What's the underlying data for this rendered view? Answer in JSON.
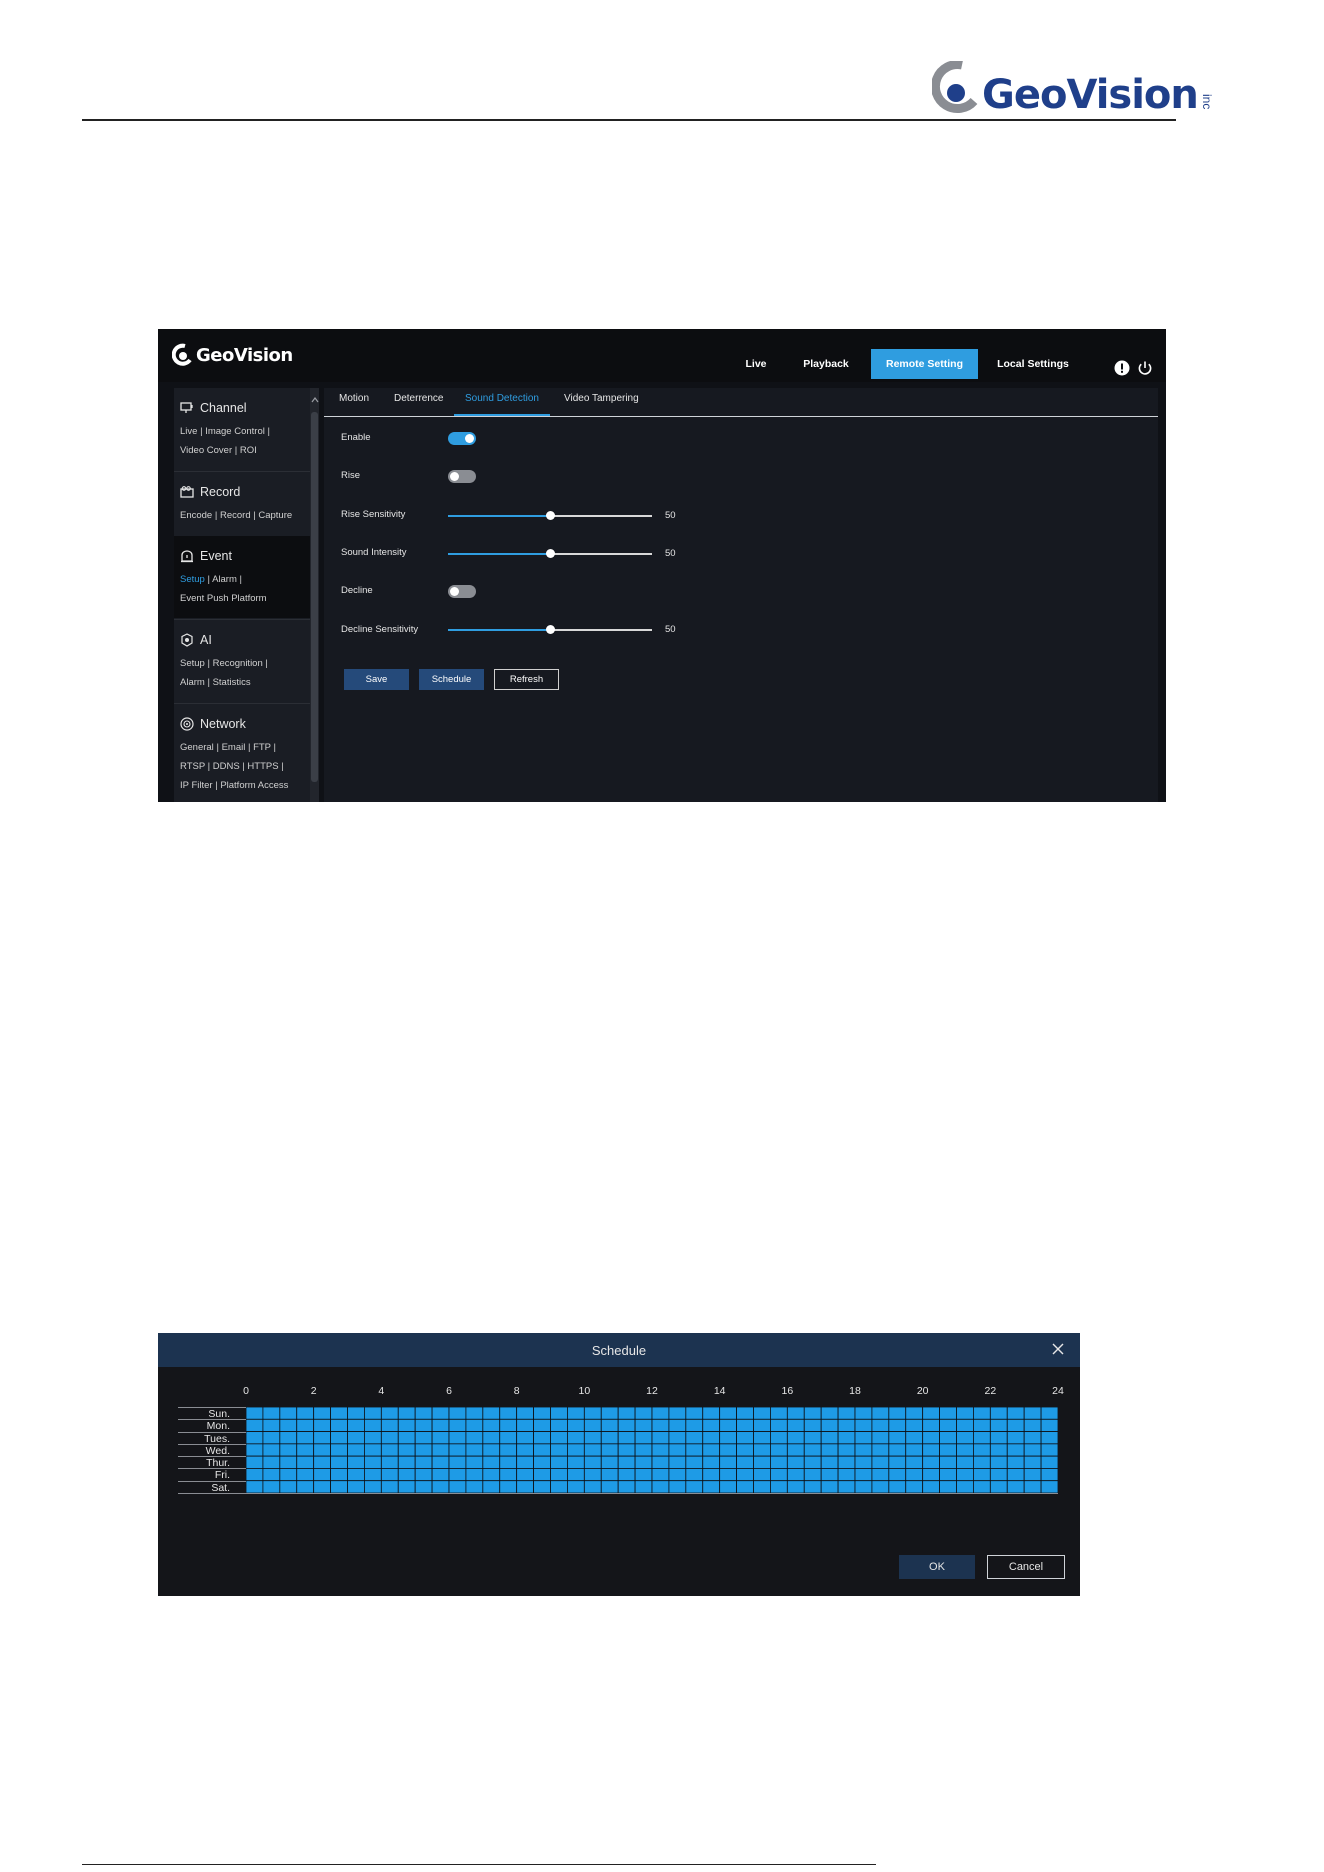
{
  "page_header": {
    "brand": "GeoVision",
    "brand_suffix": "inc"
  },
  "app": {
    "brand": "GeoVision",
    "nav": [
      {
        "label": "Live"
      },
      {
        "label": "Playback"
      },
      {
        "label": "Remote Setting"
      },
      {
        "label": "Local Settings"
      }
    ],
    "sidebar": {
      "channel": {
        "title": "Channel",
        "links": [
          "Live",
          "Image Control",
          "Video Cover",
          "ROI"
        ]
      },
      "record": {
        "title": "Record",
        "links": [
          "Encode",
          "Record",
          "Capture"
        ]
      },
      "event": {
        "title": "Event",
        "links": [
          "Setup",
          "Alarm",
          "Event Push Platform"
        ]
      },
      "ai": {
        "title": "AI",
        "links": [
          "Setup",
          "Recognition",
          "Alarm",
          "Statistics"
        ]
      },
      "network": {
        "title": "Network",
        "links": [
          "General",
          "Email",
          "FTP",
          "RTSP",
          "DDNS",
          "HTTPS",
          "IP Filter",
          "Platform Access"
        ]
      }
    },
    "tabs": [
      {
        "label": "Motion"
      },
      {
        "label": "Deterrence"
      },
      {
        "label": "Sound Detection"
      },
      {
        "label": "Video Tampering"
      }
    ],
    "form": {
      "enable": {
        "label": "Enable",
        "on": true
      },
      "rise": {
        "label": "Rise",
        "on": false
      },
      "rise_sensitivity": {
        "label": "Rise Sensitivity",
        "value": "50"
      },
      "sound_intensity": {
        "label": "Sound Intensity",
        "value": "50"
      },
      "decline": {
        "label": "Decline",
        "on": false
      },
      "decline_sensitivity": {
        "label": "Decline Sensitivity",
        "value": "50"
      }
    },
    "buttons": {
      "save": "Save",
      "schedule": "Schedule",
      "refresh": "Refresh"
    },
    "colors": {
      "accent": "#2f9de0",
      "background": "#0f1116",
      "panel": "#161920"
    }
  },
  "schedule": {
    "title": "Schedule",
    "hour_labels": [
      "0",
      "2",
      "4",
      "6",
      "8",
      "10",
      "12",
      "14",
      "16",
      "18",
      "20",
      "22",
      "24"
    ],
    "days": [
      "Sun.",
      "Mon.",
      "Tues.",
      "Wed.",
      "Thur.",
      "Fri.",
      "Sat."
    ],
    "slots_per_day": 48,
    "all_selected": true,
    "buttons": {
      "ok": "OK",
      "cancel": "Cancel"
    },
    "colors": {
      "selected": "#1e9be6",
      "grid_line": "#0d0e12"
    }
  }
}
